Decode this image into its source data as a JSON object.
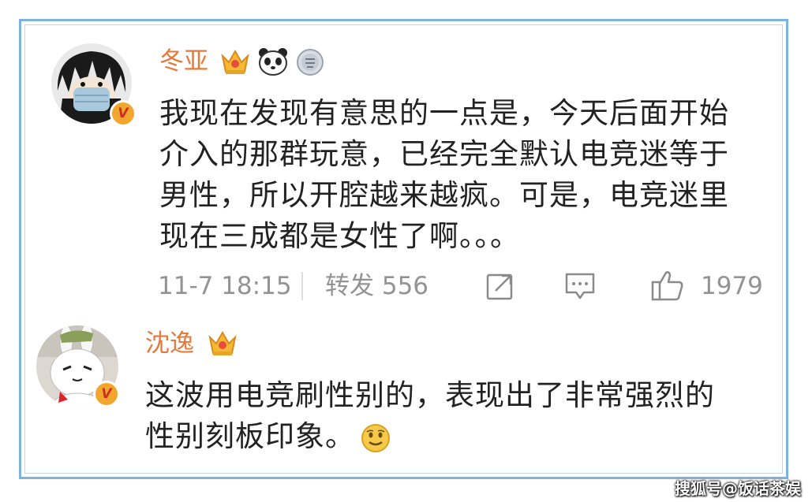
{
  "comments": [
    {
      "username": "冬亚",
      "body_lines": [
        "我现在发现有意思的一点是，今天后面开始",
        "介入的那群玩意，已经完全默认电竞迷等于",
        "男性，所以开腔越来越疯。可是，电竞迷里",
        "现在三成都是女性了啊。。。"
      ],
      "timestamp": "11-7 18:15",
      "repost_label": "转发",
      "repost_count": "556",
      "like_count": "1979"
    },
    {
      "username": "沈逸",
      "body_lines": [
        "这波用电竞刷性别的，表现出了非常强烈的",
        "性别刻板印象。"
      ]
    }
  ],
  "verified_mark": "V",
  "watermark": "搜狐号@饭话茶娱",
  "colors": {
    "username": "#e4793b",
    "frame_border": "#7fb2dc",
    "meta": "#939393",
    "verified_badge": "#f2a62e"
  },
  "icons": [
    "crown-badge-icon",
    "panda-badge-icon",
    "medal-badge-icon",
    "repost-icon",
    "comment-icon",
    "like-icon",
    "smile-emoji-icon"
  ]
}
